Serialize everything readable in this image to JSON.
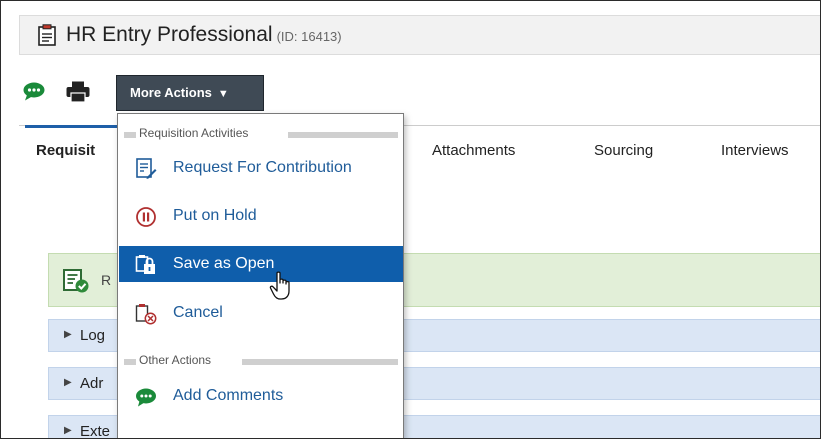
{
  "header": {
    "title": "HR Entry Professional",
    "id_text": "(ID: 16413)"
  },
  "toolbar": {
    "more_actions_label": "More Actions",
    "more_actions_caret": "▼"
  },
  "tabs": [
    {
      "label": "Requisit",
      "active": true
    },
    {
      "label": "Attachments",
      "active": false
    },
    {
      "label": "Sourcing",
      "active": false
    },
    {
      "label": "Interviews",
      "active": false
    }
  ],
  "banner": {
    "text": "R"
  },
  "accordion": [
    {
      "label": "Log"
    },
    {
      "label": "Adr"
    },
    {
      "label": "Exte"
    }
  ],
  "dropdown": {
    "section1_label": "Requisition Activities",
    "items1": [
      {
        "label": "Request For Contribution",
        "icon": "request-contribution-icon"
      },
      {
        "label": "Put on Hold",
        "icon": "pause-icon"
      },
      {
        "label": "Save as Open",
        "icon": "save-open-icon",
        "highlighted": true
      },
      {
        "label": "Cancel",
        "icon": "cancel-doc-icon"
      }
    ],
    "section2_label": "Other Actions",
    "items2": [
      {
        "label": "Add Comments",
        "icon": "comment-icon"
      }
    ]
  },
  "colors": {
    "accent": "#1e5fa8",
    "highlight": "#0f5eab",
    "button_dark": "#3f4a55",
    "comment_green": "#1a8a3a",
    "banner_green": "#e2efd8",
    "row_blue": "#dbe6f5",
    "hold_red": "#b03030"
  }
}
